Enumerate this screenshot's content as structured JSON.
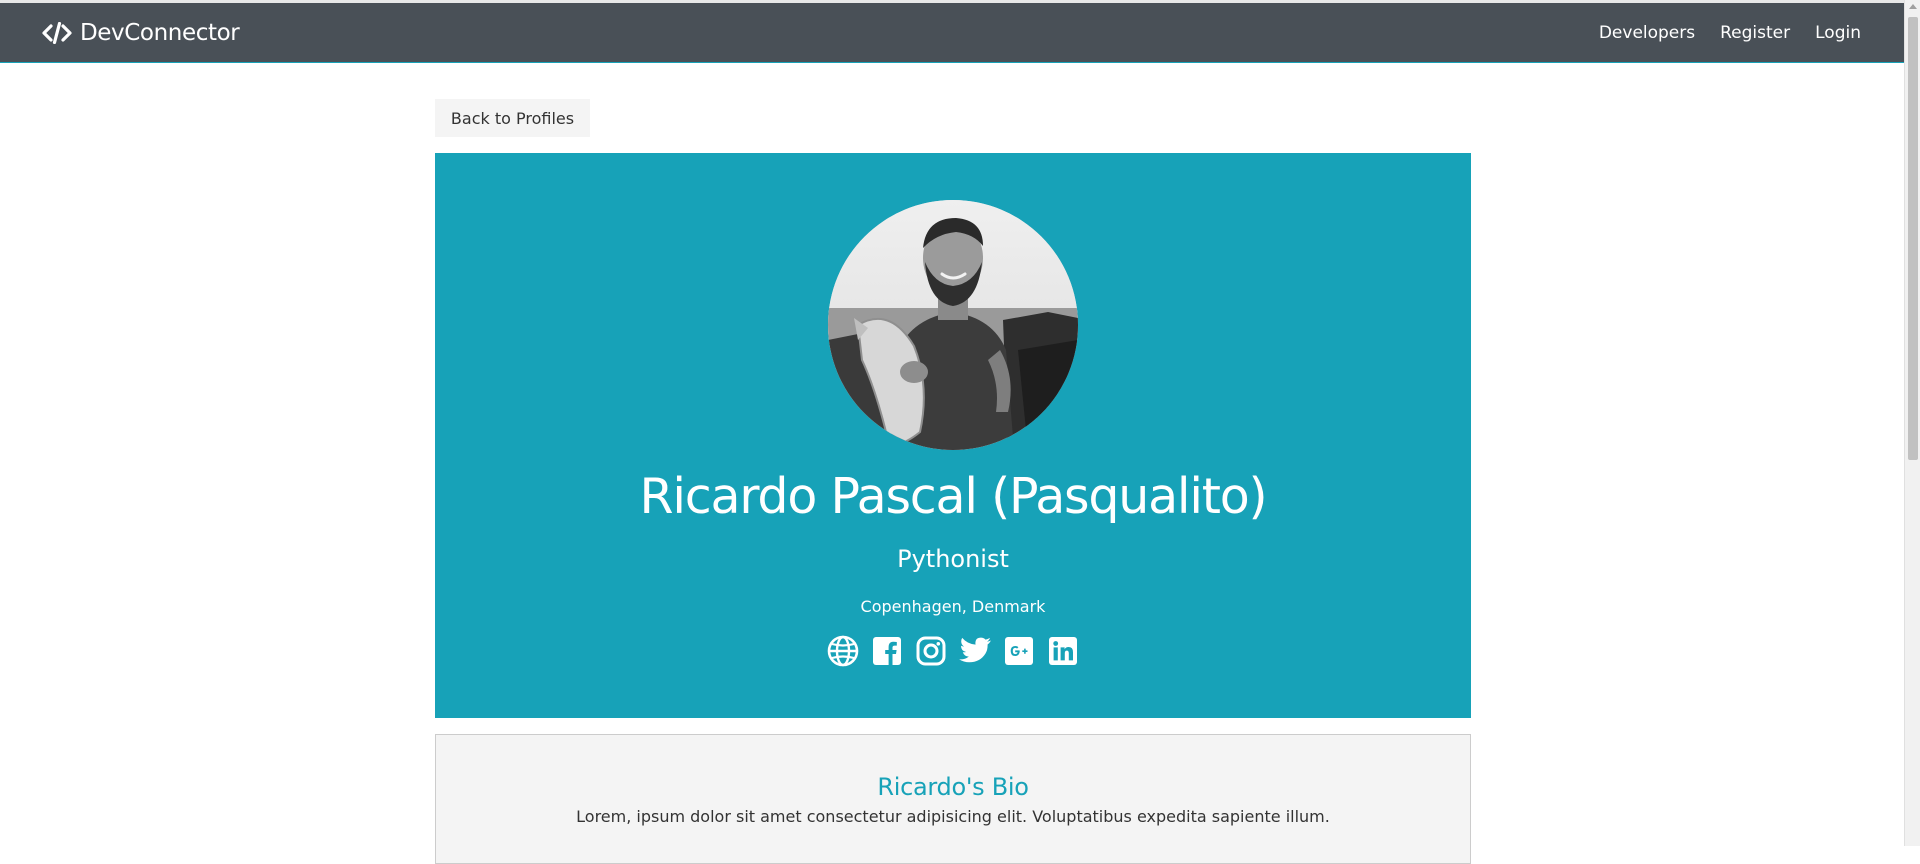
{
  "navbar": {
    "brand": "DevConnector",
    "brand_icon": "code-icon",
    "links": [
      {
        "label": "Developers"
      },
      {
        "label": "Register"
      },
      {
        "label": "Login"
      }
    ]
  },
  "actions": {
    "back_label": "Back to Profiles"
  },
  "profile": {
    "name": "Ricardo Pascal (Pasqualito)",
    "status": "Pythonist",
    "location": "Copenhagen, Denmark",
    "social_icons": [
      "globe-icon",
      "facebook-icon",
      "instagram-icon",
      "twitter-icon",
      "google-plus-icon",
      "linkedin-icon"
    ]
  },
  "bio": {
    "title": "Ricardo's Bio",
    "text": "Lorem, ipsum dolor sit amet consectetur adipisicing elit. Voluptatibus expedita sapiente illum."
  },
  "colors": {
    "primary": "#17a2b8",
    "navbar": "#495057",
    "light": "#f4f4f4",
    "text": "#333333"
  }
}
